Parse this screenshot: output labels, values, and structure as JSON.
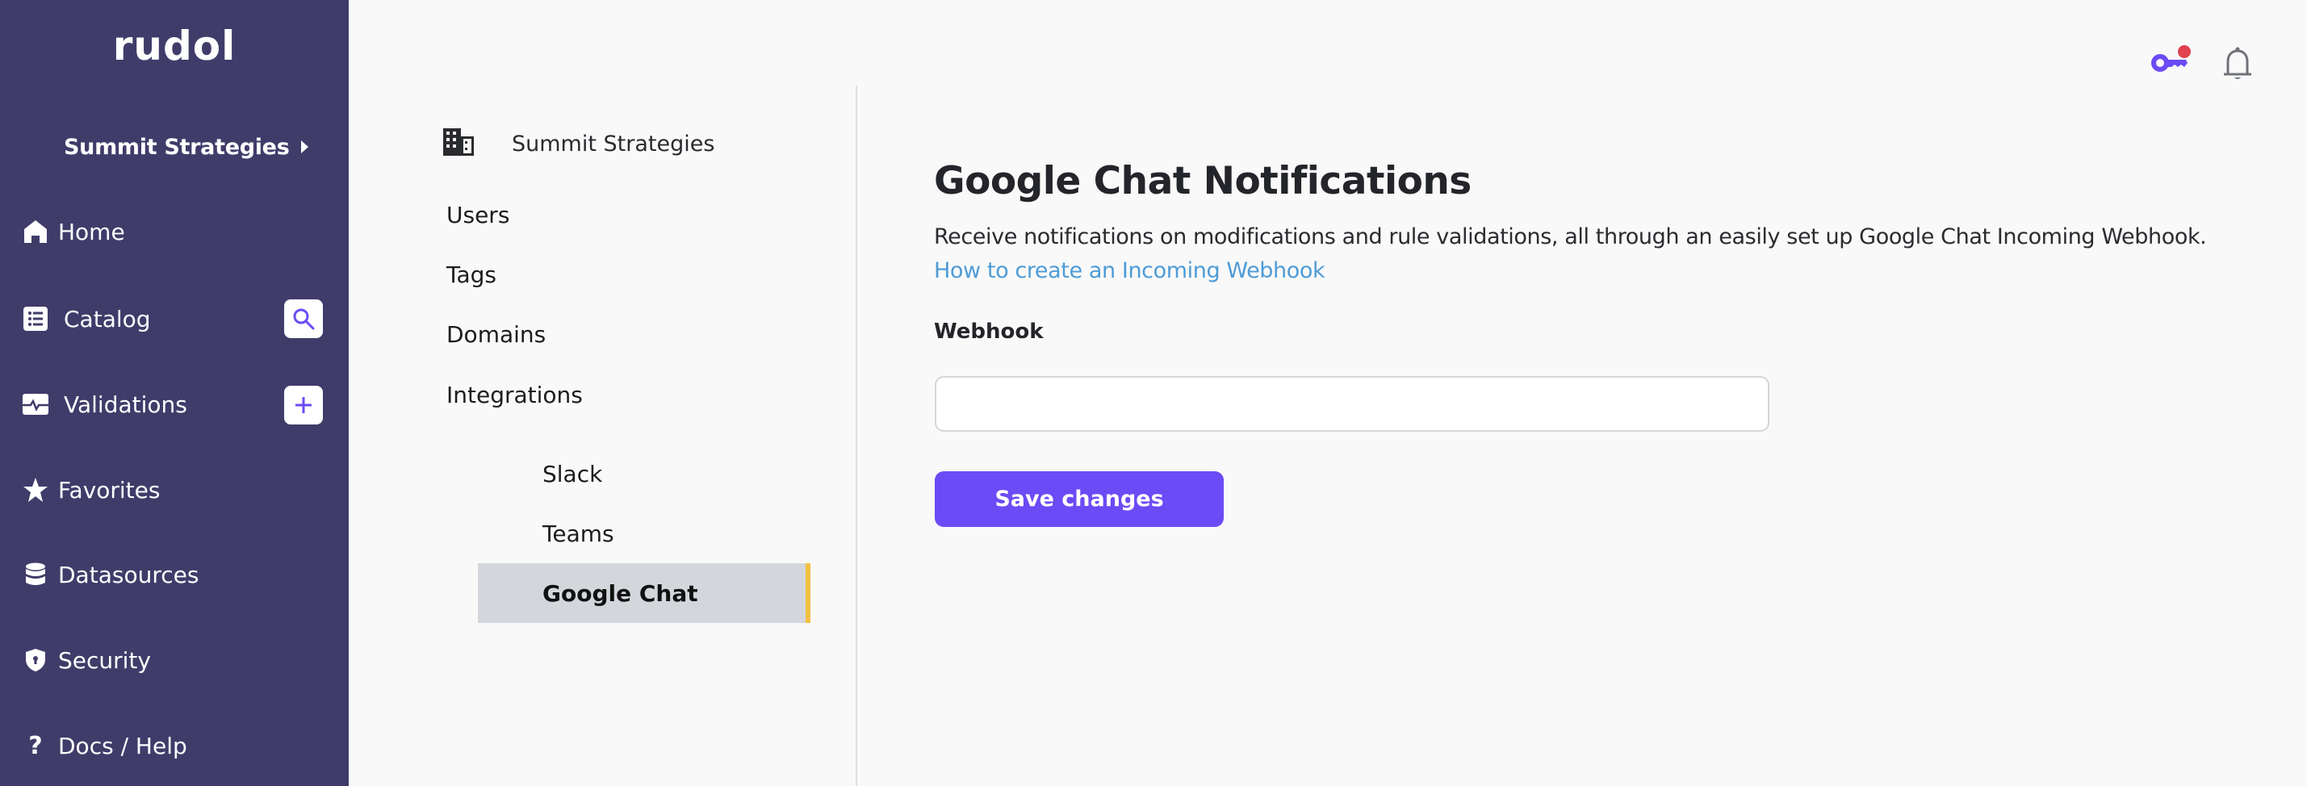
{
  "app": {
    "logo": "rudol",
    "org_switcher": "Summit Strategies"
  },
  "sidebar": {
    "items": [
      {
        "label": "Home",
        "icon": "home-icon"
      },
      {
        "label": "Catalog",
        "icon": "list-icon",
        "action": "search-icon"
      },
      {
        "label": "Validations",
        "icon": "pulse-icon",
        "action": "plus-icon"
      },
      {
        "label": "Favorites",
        "icon": "star-icon"
      },
      {
        "label": "Datasources",
        "icon": "database-icon"
      },
      {
        "label": "Security",
        "icon": "shield-lock-icon"
      },
      {
        "label": "Docs / Help",
        "icon": "question-icon"
      }
    ]
  },
  "settings_nav": {
    "org_title": "Summit Strategies",
    "items": [
      "Users",
      "Tags",
      "Domains",
      "Integrations"
    ],
    "integrations": [
      "Slack",
      "Teams",
      "Google Chat"
    ],
    "active": "Google Chat"
  },
  "main": {
    "title": "Google Chat Notifications",
    "description": "Receive notifications on modifications and rule validations, all through an easily set up Google Chat Incoming Webhook.",
    "help_link": "How to create an Incoming Webhook",
    "webhook_label": "Webhook",
    "webhook_value": "",
    "save_label": "Save changes"
  },
  "colors": {
    "sidebar_bg": "#403c6a",
    "accent": "#6b4bf5",
    "link": "#4e9bd6",
    "active_marker": "#f3c041",
    "notification_dot": "#e0424f"
  }
}
